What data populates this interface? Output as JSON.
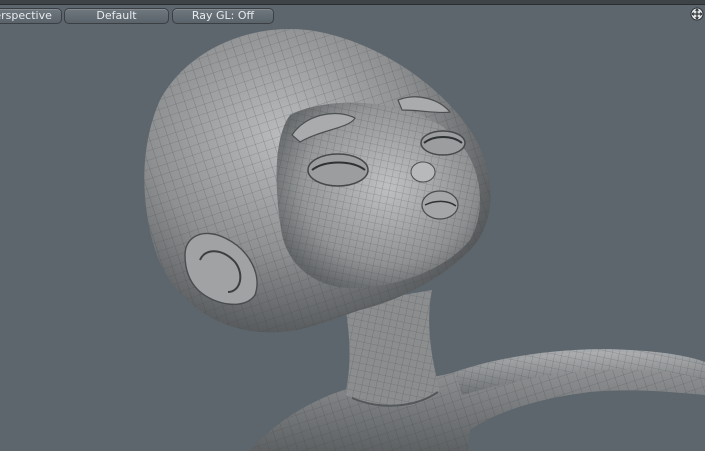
{
  "viewport": {
    "view_mode_label": "Perspective",
    "shading_label": "Default",
    "raygl_label": "Ray GL: Off",
    "background_color": "#5d666d",
    "nav_icon": "move-navigate-icon"
  },
  "scene": {
    "subject": "3d-character-wireframe-mesh",
    "mesh_color": "#8a8c8e"
  }
}
